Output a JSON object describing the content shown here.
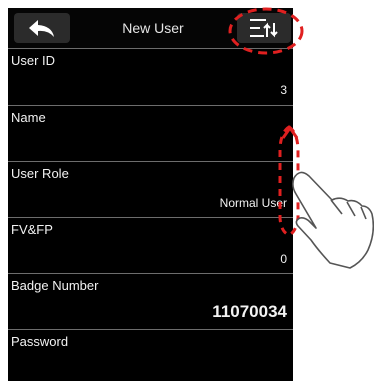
{
  "header": {
    "title": "New User",
    "back_icon": "back-arrow-icon",
    "menu_icon": "sort-menu-icon"
  },
  "fields": [
    {
      "label": "User ID",
      "value": "3"
    },
    {
      "label": "Name",
      "value": ""
    },
    {
      "label": "User Role",
      "value": "Normal User"
    },
    {
      "label": "FV&FP",
      "value": "0"
    },
    {
      "label": "Badge Number",
      "value": "11070034"
    },
    {
      "label": "Password",
      "value": ""
    }
  ],
  "annotations": {
    "highlight_color": "#e02020",
    "gesture_icon": "swipe-hand-icon"
  }
}
